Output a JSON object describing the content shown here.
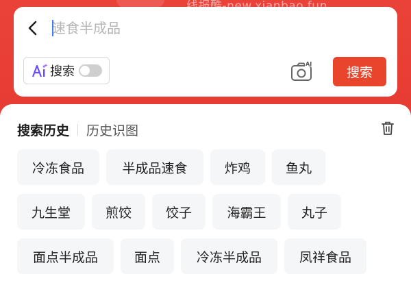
{
  "watermark": "线报酷-new.xianbao.fun",
  "search": {
    "placeholder": "速食半成品",
    "ai_label": "搜索",
    "button_label": "搜索"
  },
  "history": {
    "tab_history": "搜索历史",
    "tab_image_history": "历史识图",
    "rows": [
      [
        "冷冻食品",
        "半成品速食",
        "炸鸡",
        "鱼丸"
      ],
      [
        "九生堂",
        "煎饺",
        "饺子",
        "海霸王",
        "丸子"
      ],
      [
        "面点半成品",
        "面点",
        "冷冻半成品",
        "凤祥食品"
      ]
    ]
  },
  "icons": {
    "back": "chevron-left-icon",
    "ai": "ai-sparkle-icon",
    "camera": "ai-camera-icon",
    "trash": "trash-icon"
  },
  "colors": {
    "brand_red": "#e53b34",
    "search_button": "#e8452c",
    "caret": "#3a7cf6"
  }
}
